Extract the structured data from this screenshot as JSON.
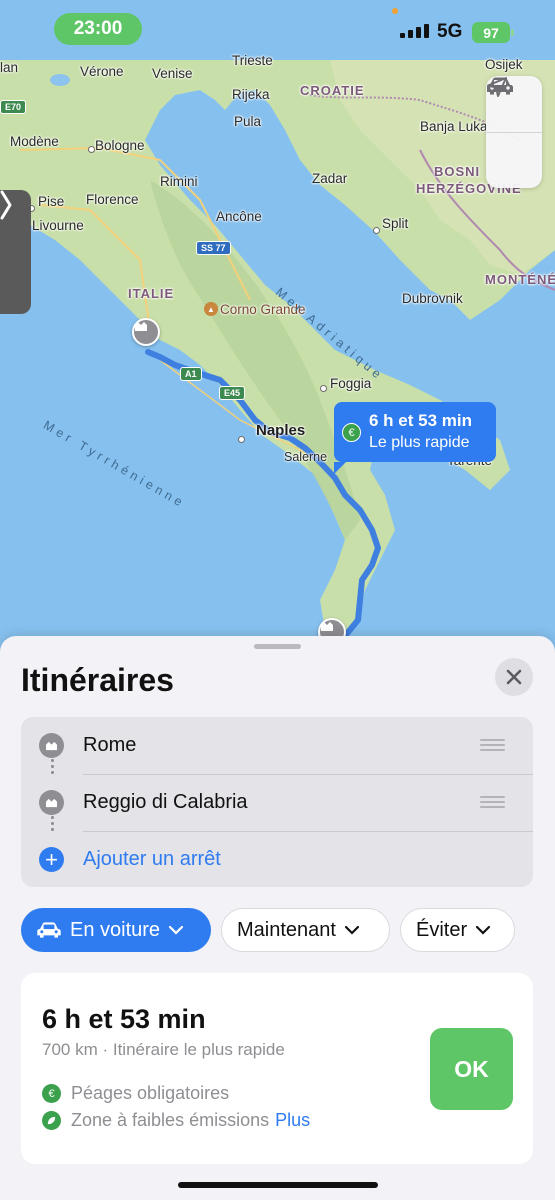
{
  "status_bar": {
    "time": "23:00",
    "network": "5G",
    "battery": "97"
  },
  "map": {
    "labels": {
      "milan": "lan",
      "verone": "Vérone",
      "venise": "Venise",
      "trieste": "Trieste",
      "rijeka": "Rijeka",
      "croatie": "CROATIE",
      "osijek": "Osijek",
      "modene": "Modène",
      "bologne": "Bologne",
      "pula": "Pula",
      "banja_luka": "Banja Luka",
      "rimini": "Rimini",
      "zadar": "Zadar",
      "bosnie": "BOSNI",
      "herzegovine": "HERZÉGOVINE",
      "pise": "Pise",
      "florence": "Florence",
      "livourne": "Livourne",
      "ancone": "Ancône",
      "split": "Split",
      "montene": "MONTÉNÉ",
      "italie": "ITALIE",
      "corno_grande": "Corno Grande",
      "dubrovnik": "Dubrovnik",
      "foggia": "Foggia",
      "naples": "Naples",
      "salerne": "Salerne",
      "tarente": "Tarente",
      "mer_adriatique": "Mer Adriatique",
      "mer_tyrrhenienne": "Mer Tyrrhénienne",
      "shield_e70": "E70",
      "shield_ss77": "SS 77",
      "shield_a1": "A1",
      "shield_e45": "E45"
    },
    "callout": {
      "time": "6 h et 53 min",
      "subtitle": "Le plus rapide",
      "icon": "euro-icon"
    },
    "controls": [
      "car-icon",
      "location-arrow-icon"
    ]
  },
  "sheet": {
    "title": "Itinéraires",
    "stops": [
      {
        "label": "Rome"
      },
      {
        "label": "Reggio di Calabria"
      }
    ],
    "add_stop_label": "Ajouter un arrêt",
    "chips": {
      "mode": "En voiture",
      "time": "Maintenant",
      "avoid": "Éviter"
    },
    "route": {
      "duration": "6 h et 53 min",
      "description": "700 km · Itinéraire le plus rapide",
      "notes": [
        {
          "text": "Péages obligatoires",
          "icon": "euro-icon"
        },
        {
          "text": "Zone à faibles émissions",
          "icon": "leaf-icon",
          "link": "Plus"
        }
      ],
      "ok_label": "OK"
    }
  },
  "colors": {
    "accent": "#2f7bf0",
    "go": "#5fc667",
    "route_line": "#3f7fe0"
  }
}
